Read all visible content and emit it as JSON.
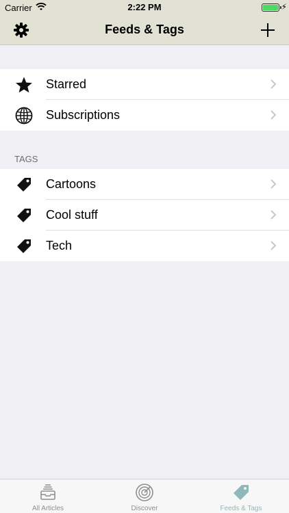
{
  "status_bar": {
    "carrier": "Carrier",
    "time": "2:22 PM"
  },
  "nav": {
    "title": "Feeds & Tags",
    "settings_icon": "gear-icon",
    "add_icon": "plus-icon"
  },
  "main_items": [
    {
      "label": "Starred",
      "icon": "star-icon"
    },
    {
      "label": "Subscriptions",
      "icon": "globe-icon"
    }
  ],
  "tags_header": "TAGS",
  "tags": [
    {
      "label": "Cartoons",
      "icon": "tag-icon"
    },
    {
      "label": "Cool stuff",
      "icon": "tag-icon"
    },
    {
      "label": "Tech",
      "icon": "tag-icon"
    }
  ],
  "tab_bar": {
    "tabs": [
      {
        "label": "All Articles",
        "icon": "inbox-icon",
        "active": false
      },
      {
        "label": "Discover",
        "icon": "radar-icon",
        "active": false
      },
      {
        "label": "Feeds & Tags",
        "icon": "tag-icon",
        "active": true
      }
    ]
  },
  "colors": {
    "nav_background": "#e2e2d4",
    "page_background": "#efeff4",
    "active_tab": "#8fb8b8",
    "inactive_tab": "#8e8e93",
    "battery": "#4cd964"
  }
}
